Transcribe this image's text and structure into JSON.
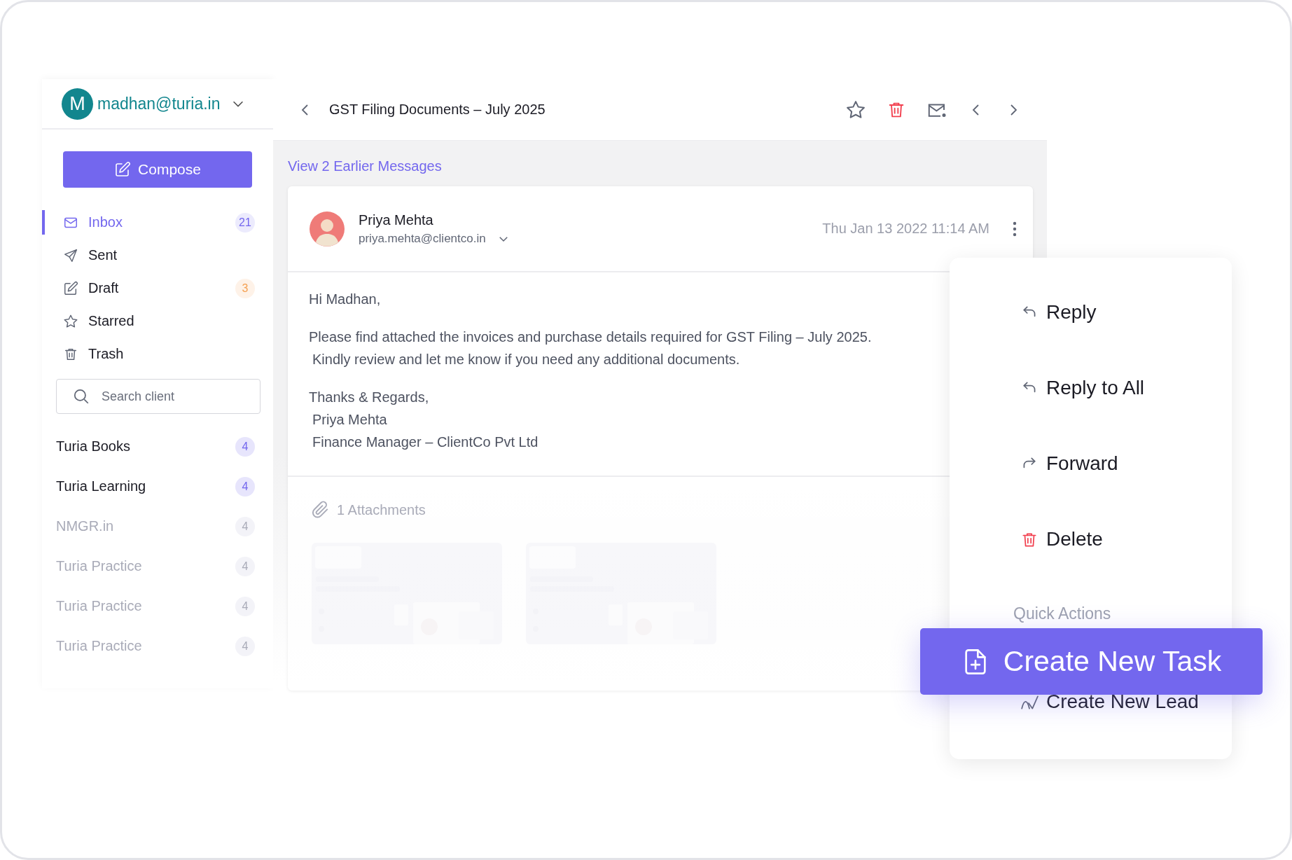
{
  "account": {
    "initial": "M",
    "email": "madhan@turia.in"
  },
  "compose": {
    "label": "Compose"
  },
  "folders": [
    {
      "label": "Inbox",
      "kind": "inbox",
      "selected": true,
      "count": "21",
      "color": "#7367ee"
    },
    {
      "label": "Sent",
      "kind": "sent",
      "selected": false
    },
    {
      "label": "Draft",
      "kind": "draft",
      "selected": false,
      "count": "3",
      "color": "#f5a153"
    },
    {
      "label": "Starred",
      "kind": "starred",
      "selected": false
    },
    {
      "label": "Trash",
      "kind": "trash",
      "selected": false
    }
  ],
  "search": {
    "placeholder": "Search client"
  },
  "clients": [
    {
      "name": "Turia Books",
      "count": "4",
      "faded": false
    },
    {
      "name": "Turia Learning",
      "count": "4",
      "faded": false
    },
    {
      "name": "NMGR.in",
      "count": "4",
      "faded": true
    },
    {
      "name": "Turia Practice",
      "count": "4",
      "faded": true
    },
    {
      "name": "Turia Practice",
      "count": "4",
      "faded": true
    },
    {
      "name": "Turia Practice",
      "count": "4",
      "faded": true
    }
  ],
  "thread": {
    "title": "GST Filing Documents – July 2025",
    "earlier_link": "View 2 Earlier Messages"
  },
  "message": {
    "sender": "Priya Mehta",
    "email": "priya.mehta@clientco.in",
    "date": "Thu Jan 13 2022 11:14 AM",
    "body": [
      [
        "Hi Madhan,"
      ],
      [
        "Please find attached the invoices and purchase details required for GST Filing – July 2025.",
        "Kindly review and let me know if you need any additional documents."
      ],
      [
        "Thanks & Regards,",
        "Priya Mehta",
        "Finance Manager – ClientCo Pvt Ltd"
      ]
    ]
  },
  "attachments": {
    "label": "1 Attachments",
    "faded": true
  },
  "menu": {
    "items": [
      {
        "label": "Reply",
        "kind": "reply"
      },
      {
        "label": "Reply to All",
        "kind": "reply-all"
      },
      {
        "label": "Forward",
        "kind": "forward"
      },
      {
        "label": "Delete",
        "kind": "delete"
      }
    ],
    "section": "Quick Actions",
    "quick_actions": [
      {
        "label": "Create New Lead",
        "kind": "lead"
      }
    ]
  },
  "floating_action": {
    "label": "Create New Task"
  }
}
